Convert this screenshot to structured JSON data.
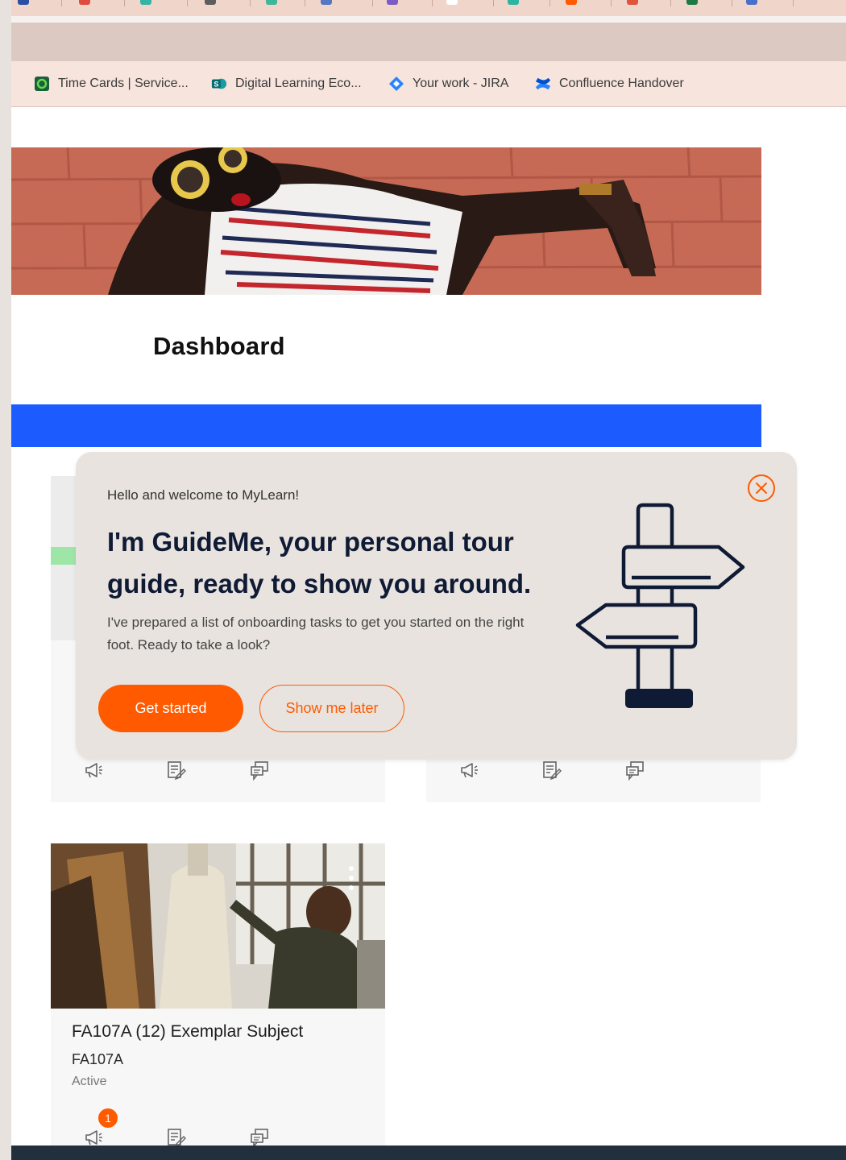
{
  "browser": {
    "bookmarks": [
      {
        "label": "Time Cards | Service...",
        "icon": "servicenow-icon"
      },
      {
        "label": "Digital Learning Eco...",
        "icon": "sharepoint-icon"
      },
      {
        "label": "Your work - JIRA",
        "icon": "jira-icon"
      },
      {
        "label": "Confluence Handover",
        "icon": "confluence-icon"
      }
    ]
  },
  "page": {
    "title": "Dashboard",
    "accent_color": "#1c5cff"
  },
  "courses": [
    {
      "title": "FA107A (12) Exemplar Subject",
      "code": "FA107A",
      "status": "Active",
      "announcement_badge": "1"
    }
  ],
  "guide_popup": {
    "greeting": "Hello  and welcome to MyLearn!",
    "headline": "I'm GuideMe, your personal tour guide, ready to show you around.",
    "body": "I've prepared a list of onboarding tasks to get you started on the right foot. Ready to take a look?",
    "primary_button": "Get started",
    "secondary_button": "Show me later",
    "accent_color": "#ff5a00"
  }
}
